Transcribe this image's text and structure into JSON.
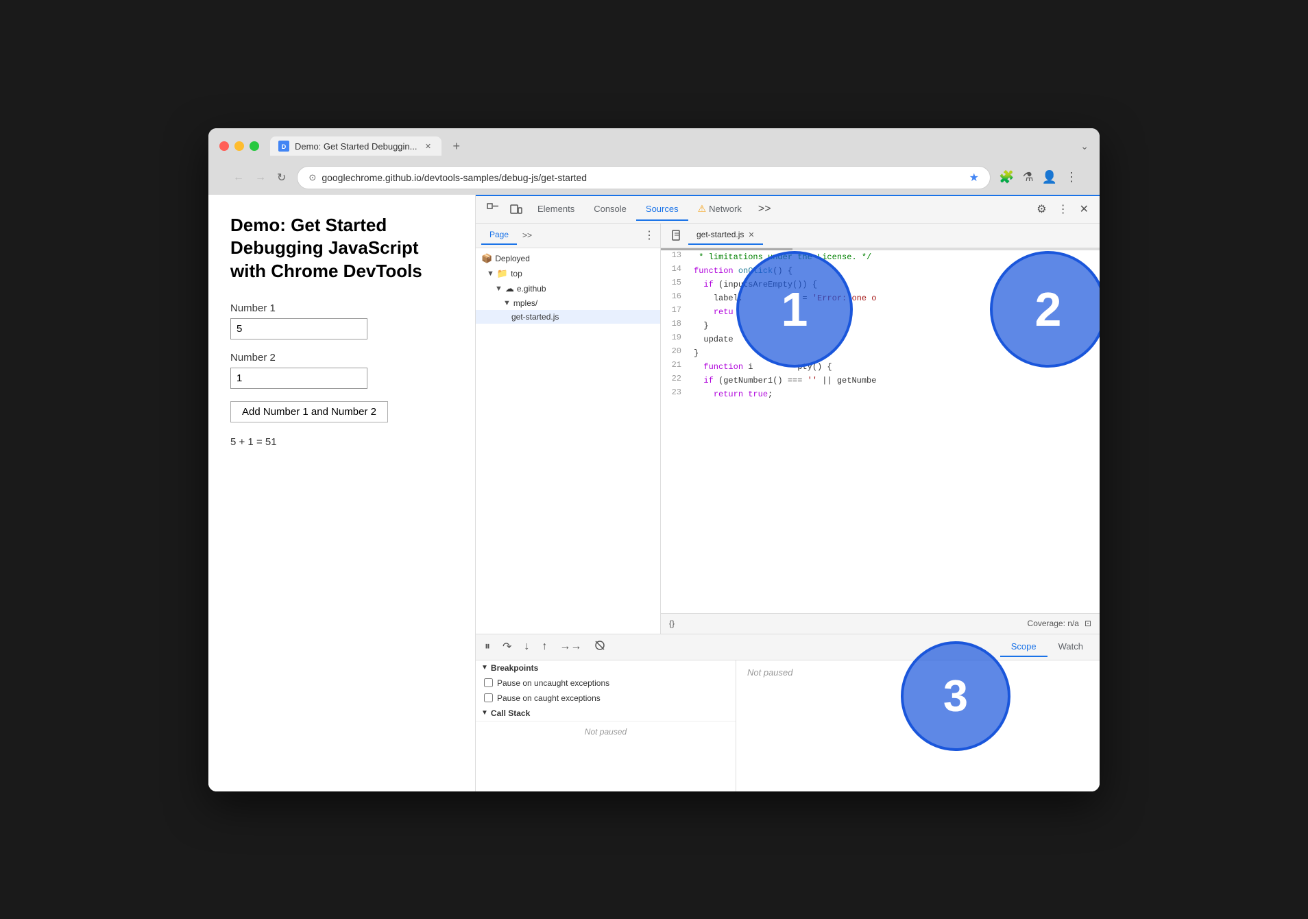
{
  "browser": {
    "tab": {
      "title": "Demo: Get Started Debuggin...",
      "favicon": "D"
    },
    "url": "googlechrome.github.io/devtools-samples/debug-js/get-started",
    "new_tab_label": "+",
    "chevron": "⌄"
  },
  "webpage": {
    "title": "Demo: Get Started Debugging JavaScript with Chrome DevTools",
    "number1_label": "Number 1",
    "number1_value": "5",
    "number2_label": "Number 2",
    "number2_value": "1",
    "button_label": "Add Number 1 and Number 2",
    "result": "5 + 1 = 51"
  },
  "devtools": {
    "tabs": {
      "elements": "Elements",
      "console": "Console",
      "sources": "Sources",
      "network": "Network",
      "more": ">>",
      "settings_label": "⚙",
      "more_label": "⋮",
      "close_label": "✕"
    },
    "sources_panel": {
      "page_tab": "Page",
      "page_more": ">>",
      "nodes": [
        {
          "label": "Deployed",
          "icon": "📦",
          "indent": 0,
          "toggle": ""
        },
        {
          "label": "top",
          "icon": "📁",
          "indent": 1,
          "toggle": "▼"
        },
        {
          "label": "e.github",
          "icon": "☁",
          "indent": 2,
          "toggle": "▼"
        },
        {
          "label": "mples/",
          "icon": "",
          "indent": 3,
          "toggle": "▼"
        },
        {
          "label": "get-started.js",
          "icon": "",
          "indent": 4,
          "toggle": "",
          "selected": true
        }
      ]
    },
    "editor": {
      "filename": "get-started.js",
      "lines": [
        {
          "num": 13,
          "code": " * limitations under the License. */",
          "type": "comment"
        },
        {
          "num": 14,
          "code": "function onClick() {",
          "type": "code"
        },
        {
          "num": 15,
          "code": "  if (inputsAreEmpty()) {",
          "type": "code"
        },
        {
          "num": 16,
          "code": "    label.            = 'Error: one o",
          "type": "code"
        },
        {
          "num": 17,
          "code": "    retu",
          "type": "code"
        },
        {
          "num": 18,
          "code": "  }",
          "type": "code"
        },
        {
          "num": 19,
          "code": "  update",
          "type": "code"
        },
        {
          "num": 20,
          "code": "}",
          "type": "code"
        },
        {
          "num": 21,
          "code": "function i         pty() {",
          "type": "code"
        },
        {
          "num": 22,
          "code": "  if (getNumber1() === '' || getNumbe",
          "type": "code"
        },
        {
          "num": 23,
          "code": "    return true;",
          "type": "code"
        }
      ],
      "coverage": "Coverage: n/a",
      "format_btn": "{}"
    }
  },
  "bottom_panel": {
    "toolbar_icons": [
      "⏸",
      "↺",
      "↓",
      "↑",
      "→→",
      "⛔"
    ],
    "tabs": [
      "Scope",
      "Watch"
    ],
    "active_tab": "Scope",
    "not_paused": "Not paused",
    "sections": {
      "breakpoints": {
        "label": "Breakpoints",
        "items": [
          "Pause on uncaught exceptions",
          "Pause on caught exceptions"
        ]
      },
      "call_stack": {
        "label": "Call Stack"
      }
    },
    "bottom_not_paused": "Not paused"
  },
  "circles": [
    {
      "id": "1",
      "label": "1"
    },
    {
      "id": "2",
      "label": "2"
    },
    {
      "id": "3",
      "label": "3"
    }
  ]
}
